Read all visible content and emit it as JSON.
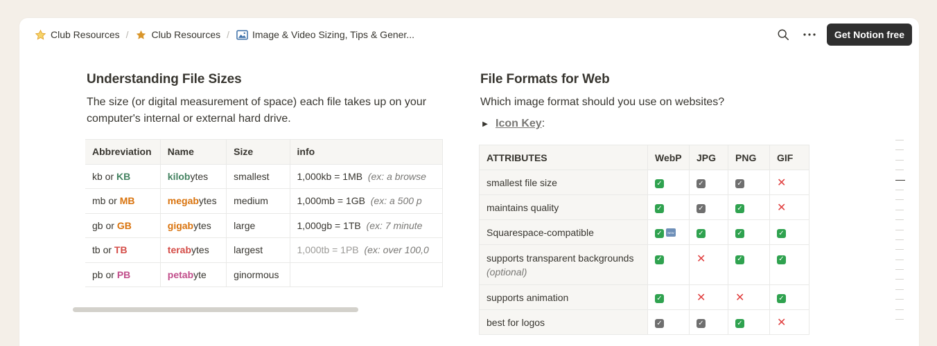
{
  "breadcrumb": {
    "items": [
      {
        "icon": "star-outline-icon",
        "label": "Club Resources"
      },
      {
        "icon": "star-filled-icon",
        "label": "Club Resources"
      },
      {
        "icon": "image-icon",
        "label": "Image & Video Sizing, Tips & Gener..."
      }
    ]
  },
  "topbar": {
    "cta_label": "Get Notion free"
  },
  "left": {
    "heading": "Understanding File Sizes",
    "paragraph": "The size (or digital measurement of space) each file takes up on your computer's internal or external hard drive.",
    "table": {
      "headers": [
        "Abbreviation",
        "Name",
        "Size",
        "info"
      ],
      "rows": [
        {
          "abbr_pre": "kb or ",
          "abbr_em": "KB",
          "name_em": "kilob",
          "name_post": "ytes",
          "size": "smallest",
          "info": "1,000kb = 1MB",
          "info_note": "(ex: a browse",
          "color": "#448361"
        },
        {
          "abbr_pre": "mb or ",
          "abbr_em": "MB",
          "name_em": "megab",
          "name_post": "ytes",
          "size": "medium",
          "info": "1,000mb = 1GB",
          "info_note": "(ex: a 500 p",
          "color": "#d9730d"
        },
        {
          "abbr_pre": "gb or ",
          "abbr_em": "GB",
          "name_em": "gigab",
          "name_post": "ytes",
          "size": "large",
          "info": "1,000gb = 1TB",
          "info_note": "(ex: 7 minute",
          "color": "#d9730d"
        },
        {
          "abbr_pre": "tb or ",
          "abbr_em": "TB",
          "name_em": "terab",
          "name_post": "ytes",
          "size": "largest",
          "info": "1,000tb = 1PB",
          "info_note": "(ex: over 100,0",
          "color": "#d44c47"
        },
        {
          "abbr_pre": "pb or ",
          "abbr_em": "PB",
          "name_em": "petab",
          "name_post": "yte",
          "size": "ginormous",
          "info": "",
          "info_note": "",
          "color": "#c14c8a"
        }
      ]
    }
  },
  "right": {
    "heading": "File Formats for Web",
    "paragraph": "Which image format should you use on websites?",
    "toggle_label": "Icon Key",
    "toggle_suffix": ":",
    "table": {
      "headers": [
        "ATTRIBUTES",
        "WebP",
        "JPG",
        "PNG",
        "GIF"
      ],
      "rows": [
        {
          "attr": "smallest file size",
          "attr_note": "",
          "cells": [
            "green",
            "gray",
            "gray",
            "x"
          ]
        },
        {
          "attr": "maintains quality",
          "attr_note": "",
          "cells": [
            "green",
            "gray",
            "green",
            "x"
          ]
        },
        {
          "attr": "Squarespace-compatible",
          "attr_note": "",
          "cells": [
            "green-new",
            "green",
            "green",
            "green"
          ]
        },
        {
          "attr": "supports transparent backgrounds",
          "attr_note": "(optional)",
          "cells": [
            "green",
            "x",
            "green",
            "green"
          ]
        },
        {
          "attr": "supports animation",
          "attr_note": "",
          "cells": [
            "green",
            "x",
            "x",
            "green"
          ]
        },
        {
          "attr": "best for logos",
          "attr_note": "",
          "cells": [
            "gray",
            "gray",
            "green",
            "x"
          ]
        }
      ]
    }
  },
  "colors": {
    "cta_bg": "#2f2f2f",
    "check_green": "#2fa24f",
    "check_gray": "#6f6f6f",
    "x_red": "#e03e3e"
  }
}
